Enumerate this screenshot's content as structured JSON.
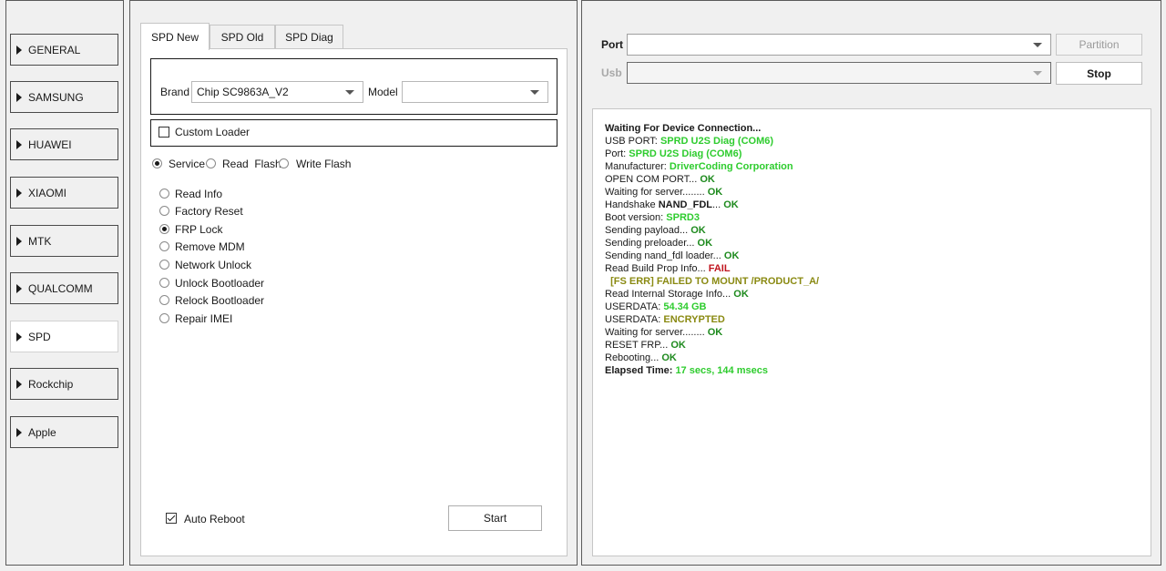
{
  "sidebar": {
    "items": [
      {
        "label": "GENERAL",
        "active": false
      },
      {
        "label": "SAMSUNG",
        "active": false
      },
      {
        "label": "HUAWEI",
        "active": false
      },
      {
        "label": "XIAOMI",
        "active": false
      },
      {
        "label": "MTK",
        "active": false
      },
      {
        "label": "QUALCOMM",
        "active": false
      },
      {
        "label": "SPD",
        "active": true
      },
      {
        "label": "Rockchip",
        "active": false
      },
      {
        "label": "Apple",
        "active": false
      }
    ]
  },
  "tabs": [
    {
      "label": "SPD New",
      "active": true
    },
    {
      "label": "SPD Old",
      "active": false
    },
    {
      "label": "SPD Diag",
      "active": false
    }
  ],
  "form": {
    "brand_label": "Brand",
    "brand_value": "Chip SC9863A_V2",
    "model_label": "Model",
    "model_value": "",
    "custom_loader_label": "Custom Loader",
    "custom_loader_checked": false,
    "modes": [
      {
        "label": "Service",
        "selected": true
      },
      {
        "label": "Read  Flash",
        "selected": false
      },
      {
        "label": "Write Flash",
        "selected": false
      }
    ],
    "operations": [
      {
        "label": "Read Info",
        "selected": false
      },
      {
        "label": "Factory Reset",
        "selected": false
      },
      {
        "label": "FRP Lock",
        "selected": true
      },
      {
        "label": "Remove MDM",
        "selected": false
      },
      {
        "label": "Network Unlock",
        "selected": false
      },
      {
        "label": "Unlock Bootloader",
        "selected": false
      },
      {
        "label": "Relock Bootloader",
        "selected": false
      },
      {
        "label": "Repair IMEI",
        "selected": false
      }
    ],
    "auto_reboot_label": "Auto Reboot",
    "auto_reboot_checked": true,
    "start_label": "Start"
  },
  "connection": {
    "port_label": "Port",
    "port_value": "",
    "usb_label": "Usb",
    "usb_value": "",
    "partition_label": "Partition",
    "stop_label": "Stop"
  },
  "log": [
    [
      {
        "t": "Waiting For Device Connection...",
        "s": "black"
      }
    ],
    [
      {
        "t": "USB PORT: ",
        "s": ""
      },
      {
        "t": "SPRD U2S Diag (COM6)",
        "s": "green"
      }
    ],
    [
      {
        "t": "Port: ",
        "s": ""
      },
      {
        "t": "SPRD U2S Diag (COM6)",
        "s": "green"
      }
    ],
    [
      {
        "t": "Manufacturer: ",
        "s": ""
      },
      {
        "t": "DriverCoding Corporation",
        "s": "green"
      }
    ],
    [
      {
        "t": "OPEN COM PORT... ",
        "s": ""
      },
      {
        "t": "OK",
        "s": "dgreen"
      }
    ],
    [
      {
        "t": "Waiting for server........ ",
        "s": ""
      },
      {
        "t": "OK",
        "s": "dgreen"
      }
    ],
    [
      {
        "t": "Handshake ",
        "s": ""
      },
      {
        "t": "NAND_FDL",
        "s": "black"
      },
      {
        "t": "... ",
        "s": ""
      },
      {
        "t": "OK",
        "s": "dgreen"
      }
    ],
    [
      {
        "t": "Boot version: ",
        "s": ""
      },
      {
        "t": "SPRD3",
        "s": "green"
      }
    ],
    [
      {
        "t": "Sending payload... ",
        "s": ""
      },
      {
        "t": "OK",
        "s": "dgreen"
      }
    ],
    [
      {
        "t": "Sending preloader... ",
        "s": ""
      },
      {
        "t": "OK",
        "s": "dgreen"
      }
    ],
    [
      {
        "t": "Sending nand_fdl loader... ",
        "s": ""
      },
      {
        "t": "OK",
        "s": "dgreen"
      }
    ],
    [
      {
        "t": "Read Build Prop Info... ",
        "s": ""
      },
      {
        "t": "FAIL",
        "s": "red"
      }
    ],
    [
      {
        "t": "  [FS ERR] FAILED TO MOUNT /PRODUCT_A/",
        "s": "olive"
      }
    ],
    [
      {
        "t": "Read Internal Storage Info... ",
        "s": ""
      },
      {
        "t": "OK",
        "s": "dgreen"
      }
    ],
    [
      {
        "t": "USERDATA: ",
        "s": ""
      },
      {
        "t": "54.34 GB",
        "s": "green"
      }
    ],
    [
      {
        "t": "USERDATA: ",
        "s": ""
      },
      {
        "t": "ENCRYPTED",
        "s": "olive"
      }
    ],
    [
      {
        "t": "Waiting for server........ ",
        "s": ""
      },
      {
        "t": "OK",
        "s": "dgreen"
      }
    ],
    [
      {
        "t": "RESET FRP... ",
        "s": ""
      },
      {
        "t": "OK",
        "s": "dgreen"
      }
    ],
    [
      {
        "t": "Rebooting... ",
        "s": ""
      },
      {
        "t": "OK",
        "s": "dgreen"
      }
    ],
    [
      {
        "t": "Elapsed Time: ",
        "s": "black"
      },
      {
        "t": "17 secs, 144 msecs",
        "s": "green"
      }
    ]
  ]
}
